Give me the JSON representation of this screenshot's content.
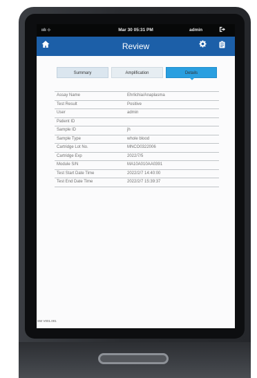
{
  "status": {
    "network_text": "ıılı ⊹",
    "datetime": "Mar 30   05:31 PM",
    "user": "admin"
  },
  "header": {
    "title": "Review"
  },
  "tabs": [
    {
      "label": "Summary"
    },
    {
      "label": "Amplification"
    },
    {
      "label": "Details"
    }
  ],
  "details": [
    {
      "key": "Assay Name",
      "value": "Ehrlichia/Anaplasma"
    },
    {
      "key": "Test Result",
      "value": "Positive"
    },
    {
      "key": "User",
      "value": "admin"
    },
    {
      "key": "Patient ID",
      "value": ""
    },
    {
      "key": "Sample ID",
      "value": "jh"
    },
    {
      "key": "Sample Type",
      "value": "whole blood"
    },
    {
      "key": "Cartridge Lot No.",
      "value": "MNCO0322006"
    },
    {
      "key": "Cartridge Exp",
      "value": "2022/7/5"
    },
    {
      "key": "Module S/N",
      "value": "MA10A010AA0391"
    },
    {
      "key": "Test Start Date Time",
      "value": "2022/2/7 14:40:00"
    },
    {
      "key": "Test End Date Time",
      "value": "2022/2/7 15:39:37"
    }
  ],
  "footer": {
    "version": "SW V001.001"
  },
  "icons": {
    "home": "home-icon",
    "settings": "gear-icon",
    "report": "clipboard-icon",
    "logout": "logout-icon"
  },
  "colors": {
    "header_bar": "#1c5fa8",
    "active_tab": "#2a9fe0",
    "status_bar": "#070808"
  }
}
